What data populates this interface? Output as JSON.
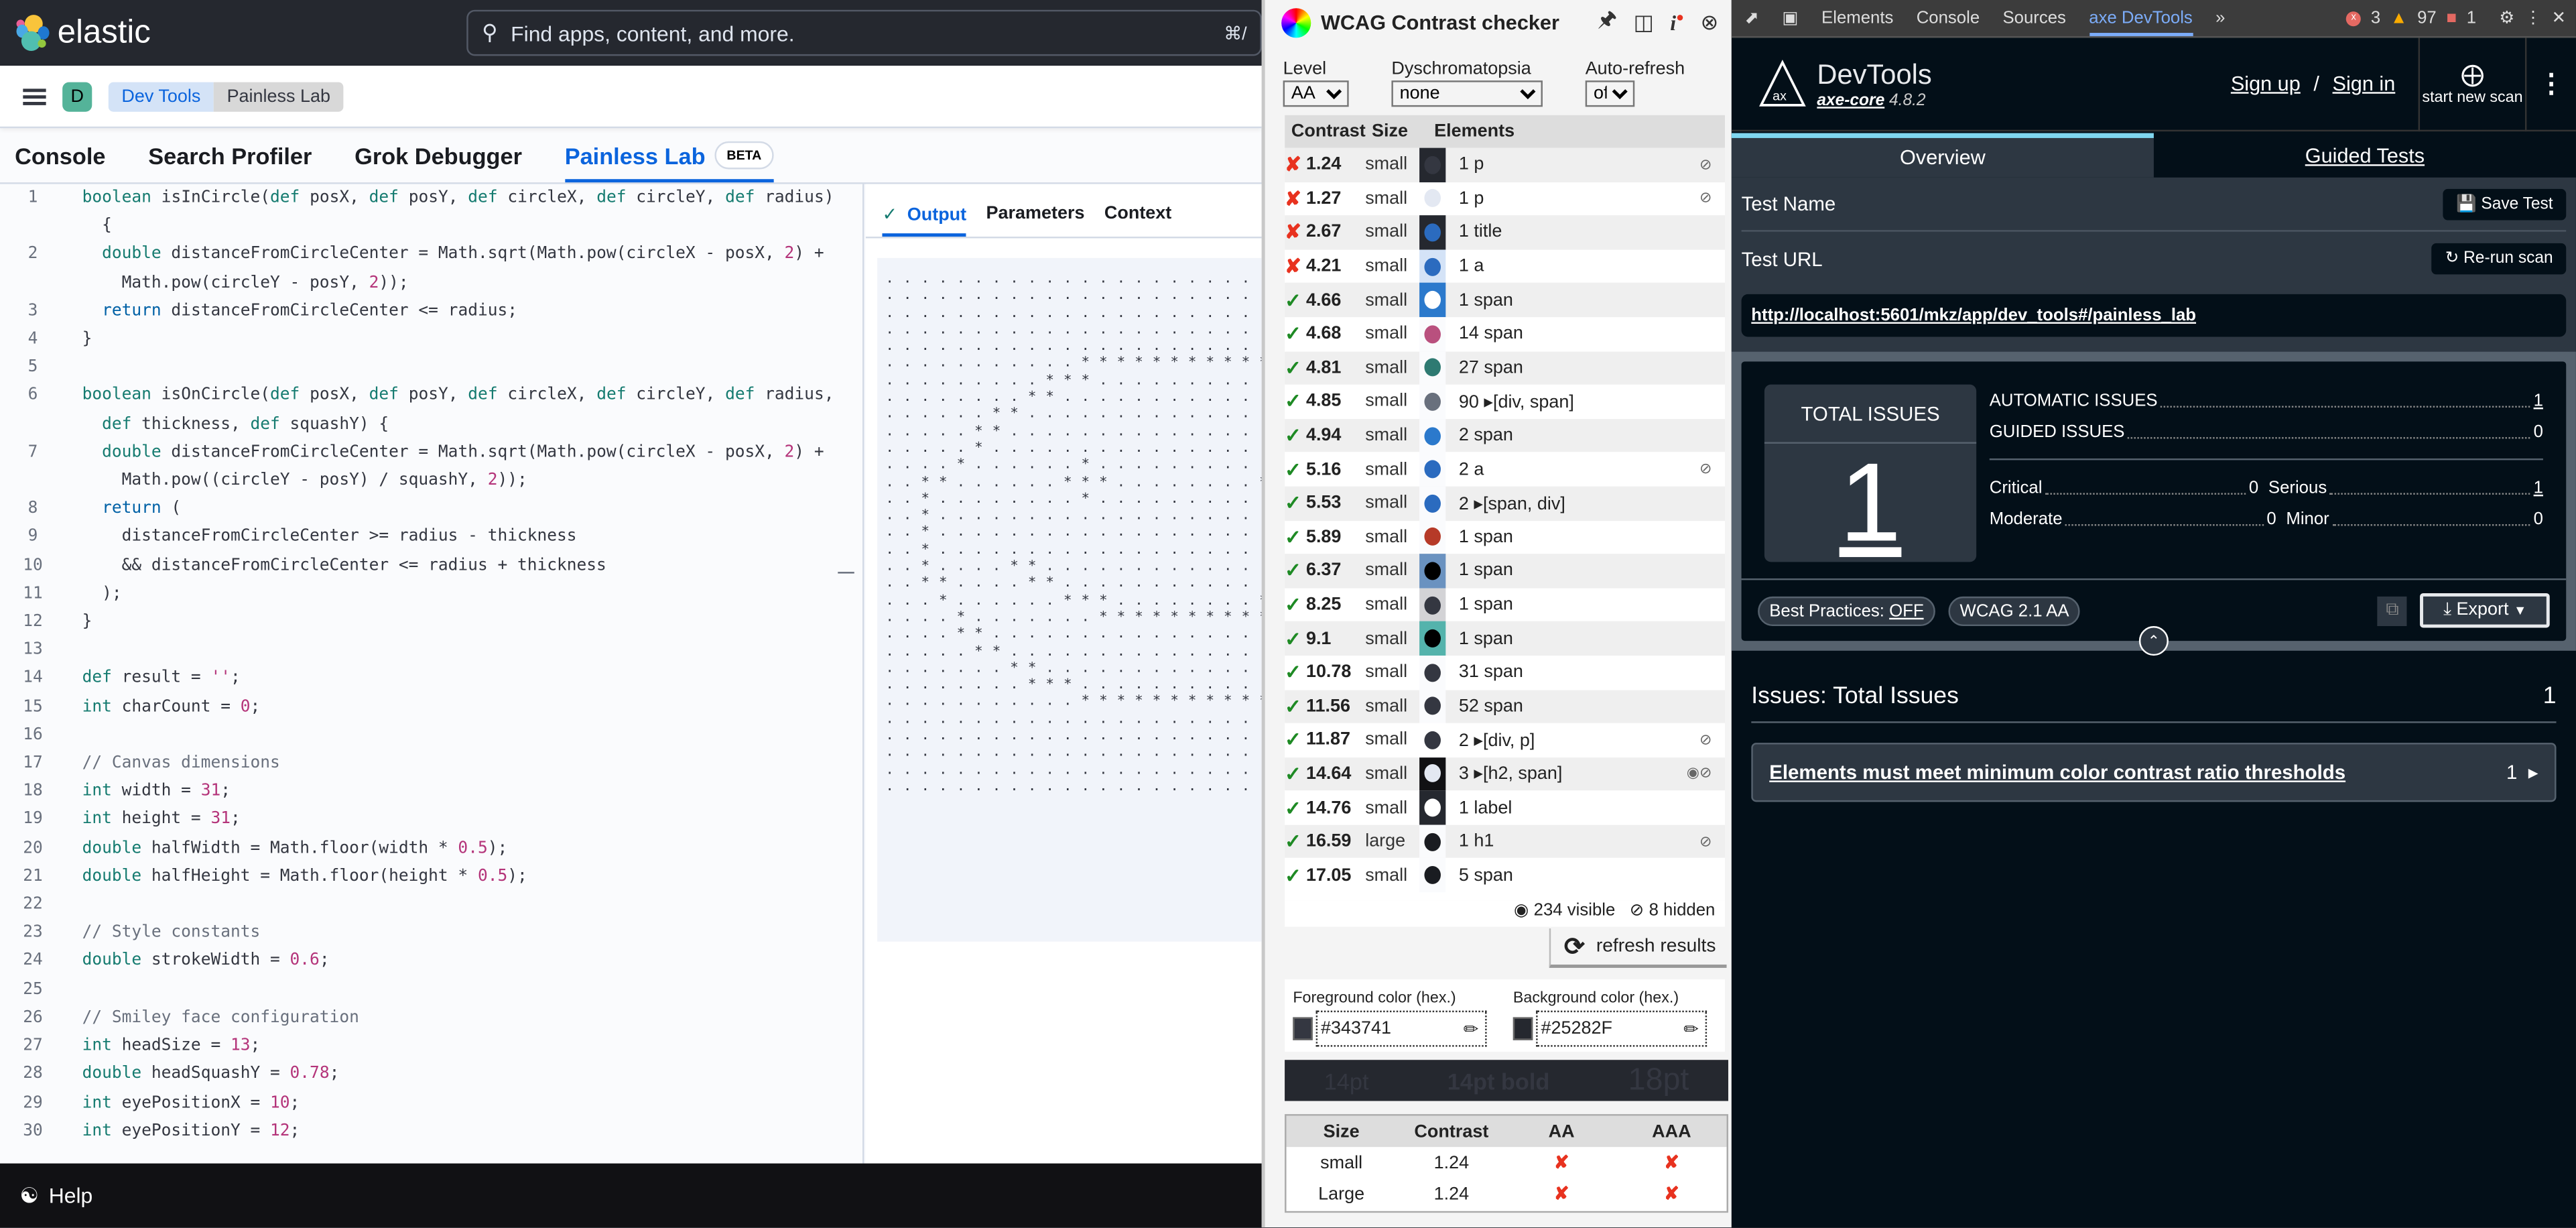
{
  "kibana": {
    "brand": "elastic",
    "search_placeholder": "Find apps, content, and more.",
    "search_shortcut": "⌘/",
    "avatar_letter": "D",
    "breadcrumbs": [
      "Dev Tools",
      "Painless Lab"
    ],
    "tabs": [
      {
        "label": "Console"
      },
      {
        "label": "Search Profiler"
      },
      {
        "label": "Grok Debugger"
      },
      {
        "label": "Painless Lab",
        "badge": "BETA",
        "active": true
      }
    ],
    "output_tabs": [
      "Output",
      "Parameters",
      "Context"
    ],
    "help_label": "Help",
    "code_lines": [
      {
        "n": "1",
        "html": "<span class='k'>boolean</span> isInCircle(<span class='k'>def</span> posX, <span class='k'>def</span> posY, <span class='k'>def</span> circleX, <span class='k'>def</span> circleY, <span class='k'>def</span> radius)"
      },
      {
        "n": "",
        "html": "  {"
      },
      {
        "n": "2",
        "html": "  <span class='k'>double</span> distanceFromCircleCenter = Math.sqrt(Math.pow(circleX - posX, <span class='n'>2</span>) +"
      },
      {
        "n": "",
        "html": "    Math.pow(circleY - posY, <span class='n'>2</span>));"
      },
      {
        "n": "3",
        "html": "  <span class='r'>return</span> distanceFromCircleCenter &lt;= radius;"
      },
      {
        "n": "4",
        "html": "}"
      },
      {
        "n": "5",
        "html": ""
      },
      {
        "n": "6",
        "html": "<span class='k'>boolean</span> isOnCircle(<span class='k'>def</span> posX, <span class='k'>def</span> posY, <span class='k'>def</span> circleX, <span class='k'>def</span> circleY, <span class='k'>def</span> radius,"
      },
      {
        "n": "",
        "html": "  <span class='k'>def</span> thickness, <span class='k'>def</span> squashY) {"
      },
      {
        "n": "7",
        "html": "  <span class='k'>double</span> distanceFromCircleCenter = Math.sqrt(Math.pow(circleX - posX, <span class='n'>2</span>) +"
      },
      {
        "n": "",
        "html": "    Math.pow((circleY - posY) / squashY, <span class='n'>2</span>));"
      },
      {
        "n": "8",
        "html": "  <span class='r'>return</span> ("
      },
      {
        "n": "9",
        "html": "    distanceFromCircleCenter &gt;= radius - thickness"
      },
      {
        "n": "10",
        "html": "    &amp;&amp; distanceFromCircleCenter &lt;= radius + thickness"
      },
      {
        "n": "11",
        "html": "  );"
      },
      {
        "n": "12",
        "html": "}"
      },
      {
        "n": "13",
        "html": ""
      },
      {
        "n": "14",
        "html": "<span class='k'>def</span> result = <span class='n'>''</span>;"
      },
      {
        "n": "15",
        "html": "<span class='k'>int</span> charCount = <span class='n'>0</span>;"
      },
      {
        "n": "16",
        "html": ""
      },
      {
        "n": "17",
        "html": "<span class='c'>// Canvas dimensions</span>"
      },
      {
        "n": "18",
        "html": "<span class='k'>int</span> width = <span class='n'>31</span>;"
      },
      {
        "n": "19",
        "html": "<span class='k'>int</span> height = <span class='n'>31</span>;"
      },
      {
        "n": "20",
        "html": "<span class='k'>double</span> halfWidth = Math.floor(width * <span class='n'>0.5</span>);"
      },
      {
        "n": "21",
        "html": "<span class='k'>double</span> halfHeight = Math.floor(height * <span class='n'>0.5</span>);"
      },
      {
        "n": "22",
        "html": ""
      },
      {
        "n": "23",
        "html": "<span class='c'>// Style constants</span>"
      },
      {
        "n": "24",
        "html": "<span class='k'>double</span> strokeWidth = <span class='n'>0.6</span>;"
      },
      {
        "n": "25",
        "html": ""
      },
      {
        "n": "26",
        "html": "<span class='c'>// Smiley face configuration</span>"
      },
      {
        "n": "27",
        "html": "<span class='k'>int</span> headSize = <span class='n'>13</span>;"
      },
      {
        "n": "28",
        "html": "<span class='k'>double</span> headSquashY = <span class='n'>0.78</span>;"
      },
      {
        "n": "29",
        "html": "<span class='k'>int</span> eyePositionX = <span class='n'>10</span>;"
      },
      {
        "n": "30",
        "html": "<span class='k'>int</span> eyePositionY = <span class='n'>12</span>;"
      }
    ],
    "output_text": ". . . . . . . . . . . . . . . . . . . . . .\n. . . . . . . . . . . . . . . . . . . . . .\n. . . . . . . . . . . . . . . . . . . . . .\n. . . . . . . . . . . . . . . . . . . . . .\n. . . . . . . . . . . . . . . . . . . . . .\n. . . . . . . . . . . * * * * * * * * * * *\n. . . . . . . . . * * * . . . . . . . . . .\n. . . . . . . . * * . . . . . . . . . . . .\n. . . . . . * * . . . . . . . . . . . . . .\n. . . . . * * . . . . . . . . . . . . . . .\n. . . . . * . . . . . . . . . . . . . . . .\n. . . . * . . . . . . * . . . . . . . . . .\n. . * * . . . . . . * * * . . . . . . . . *\n. . * . . . . . . . . * . . . . . . . . . .\n. . * . . . . . . . . . . . . . . . . . . .\n. . * . . . . . . . . . . . . . . . . . . .\n. . * . . . . . . . . . . . . . . . . . . .\n. . * . . . . * * . . . . . . . . . . . . .\n. . * * . . . . * * . . . . . . . . . . . .\n. . . * . . . . . . * * * . . . . . . . . *\n. . . . * . . . . . . . * * * * * * * * * *\n. . . . * * . . . . . . . . . . . . . . . .\n. . . . . * * . . . . . . . . . . . . . . .\n. . . . . . . * * . . . . . . . . . . . . .\n. . . . . . . . * * * . . . . . . . . . . .\n. . . . . . . . . . . * * * * * * * * * * *\n. . . . . . . . . . . . . . . . . . . . . .\n. . . . . . . . . . . . . . . . . . . . . .\n. . . . . . . . . . . . . . . . . . . . . .\n. . . . . . . . . . . . . . . . . . . . . .\n. . . . . . . . . . . . . . . . . . . . . ."
  },
  "wcag": {
    "title": "WCAG Contrast checker",
    "controls": {
      "level_label": "Level",
      "level_value": "AA",
      "dys_label": "Dyschromatopsia",
      "dys_value": "none",
      "auto_label": "Auto-refresh",
      "auto_value": "off"
    },
    "headers": [
      "Contrast",
      "Size",
      "Elements"
    ],
    "rows": [
      {
        "status": "fail",
        "contrast": "1.24",
        "size": "small",
        "bg": "#25282f",
        "fg": "#343741",
        "elements": "1 p",
        "hidden": true
      },
      {
        "status": "fail",
        "contrast": "1.27",
        "size": "small",
        "bg": "#ffffff",
        "fg": "#e3e8f2",
        "elements": "1 p",
        "hidden": true
      },
      {
        "status": "fail",
        "contrast": "2.67",
        "size": "small",
        "bg": "#25282f",
        "fg": "#2b6bbf",
        "elements": "1 title",
        "hidden": false
      },
      {
        "status": "fail",
        "contrast": "4.21",
        "size": "small",
        "bg": "#d4e3f7",
        "fg": "#2b6bbf",
        "elements": "1 a",
        "hidden": false
      },
      {
        "status": "pass",
        "contrast": "4.66",
        "size": "small",
        "bg": "#2b79cc",
        "fg": "#ffffff",
        "elements": "1 span",
        "hidden": false
      },
      {
        "status": "pass",
        "contrast": "4.68",
        "size": "small",
        "bg": "#fafbfd",
        "fg": "#b9507e",
        "elements": "14 span",
        "hidden": false
      },
      {
        "status": "pass",
        "contrast": "4.81",
        "size": "small",
        "bg": "#fafbfd",
        "fg": "#2e7a72",
        "elements": "27 span",
        "hidden": false
      },
      {
        "status": "pass",
        "contrast": "4.85",
        "size": "small",
        "bg": "#fafbfd",
        "fg": "#69707d",
        "elements": "90 ▸[div, span]",
        "hidden": false
      },
      {
        "status": "pass",
        "contrast": "4.94",
        "size": "small",
        "bg": "#fafbfd",
        "fg": "#2b79cc",
        "elements": "2 span",
        "hidden": false
      },
      {
        "status": "pass",
        "contrast": "5.16",
        "size": "small",
        "bg": "#fafbfd",
        "fg": "#2b6bbf",
        "elements": "2 a",
        "hidden": true
      },
      {
        "status": "pass",
        "contrast": "5.53",
        "size": "small",
        "bg": "#fafbfd",
        "fg": "#2b6bbf",
        "elements": "2 ▸[span, div]",
        "hidden": false
      },
      {
        "status": "pass",
        "contrast": "5.89",
        "size": "small",
        "bg": "#fafbfd",
        "fg": "#b63a28",
        "elements": "1 span",
        "hidden": false
      },
      {
        "status": "pass",
        "contrast": "6.37",
        "size": "small",
        "bg": "#6a92c0",
        "fg": "#000000",
        "elements": "1 span",
        "hidden": false
      },
      {
        "status": "pass",
        "contrast": "8.25",
        "size": "small",
        "bg": "#d3d3d6",
        "fg": "#343741",
        "elements": "1 span",
        "hidden": false
      },
      {
        "status": "pass",
        "contrast": "9.1",
        "size": "small",
        "bg": "#54b3ac",
        "fg": "#000000",
        "elements": "1 span",
        "hidden": false
      },
      {
        "status": "pass",
        "contrast": "10.78",
        "size": "small",
        "bg": "#fafbfd",
        "fg": "#343741",
        "elements": "31 span",
        "hidden": false
      },
      {
        "status": "pass",
        "contrast": "11.56",
        "size": "small",
        "bg": "#fafbfd",
        "fg": "#343741",
        "elements": "52 span",
        "hidden": false
      },
      {
        "status": "pass",
        "contrast": "11.87",
        "size": "small",
        "bg": "#ffffff",
        "fg": "#343741",
        "elements": "2 ▸[div, p]",
        "hidden": true
      },
      {
        "status": "pass",
        "contrast": "14.64",
        "size": "small",
        "bg": "#111114",
        "fg": "#e3e8f2",
        "elements": "3 ▸[h2, span]",
        "hidden": true,
        "visible_icon": true
      },
      {
        "status": "pass",
        "contrast": "14.76",
        "size": "small",
        "bg": "#25282f",
        "fg": "#ffffff",
        "elements": "1 label",
        "hidden": false
      },
      {
        "status": "pass",
        "contrast": "16.59",
        "size": "large",
        "bg": "#fafbfd",
        "fg": "#1a1c21",
        "elements": "1 h1",
        "hidden": true
      },
      {
        "status": "pass",
        "contrast": "17.05",
        "size": "small",
        "bg": "#fafbfd",
        "fg": "#1a1c21",
        "elements": "5 span",
        "hidden": false
      }
    ],
    "visible_count": "234 visible",
    "hidden_count": "8 hidden",
    "refresh_label": "refresh results",
    "fg_label": "Foreground color (hex.)",
    "fg_value": "#343741",
    "bg_label": "Background color (hex.)",
    "bg_value": "#25282F",
    "preview": [
      "14pt",
      "14pt bold",
      "18pt"
    ],
    "result_headers": [
      "Size",
      "Contrast",
      "AA",
      "AAA"
    ],
    "results": [
      {
        "size": "small",
        "contrast": "1.24",
        "aa": "✘",
        "aaa": "✘"
      },
      {
        "size": "Large",
        "contrast": "1.24",
        "aa": "✘",
        "aaa": "✘"
      }
    ]
  },
  "devtools": {
    "tabs": [
      "Elements",
      "Console",
      "Sources",
      "axe DevTools"
    ],
    "active_tab": "axe DevTools",
    "errors": "3",
    "warnings": "97",
    "issues": "1",
    "axe": {
      "name": "DevTools",
      "core_label": "axe-core",
      "core_version": "4.8.2",
      "sign_up": "Sign up",
      "sign_in": "Sign in",
      "start_scan": "start new scan",
      "tabs": [
        "Overview",
        "Guided Tests"
      ],
      "test_name_label": "Test Name",
      "save_test": "Save Test",
      "test_url_label": "Test URL",
      "rerun": "Re-run scan",
      "url": "http://localhost:5601/mkz/app/dev_tools#/painless_lab",
      "total_label": "TOTAL ISSUES",
      "total": "1",
      "automatic_label": "AUTOMATIC ISSUES",
      "automatic": "1",
      "guided_label": "GUIDED ISSUES",
      "guided": "0",
      "critical_label": "Critical",
      "critical": "0",
      "serious_label": "Serious",
      "serious": "1",
      "moderate_label": "Moderate",
      "moderate": "0",
      "minor_label": "Minor",
      "minor": "0",
      "best_practices": "Best Practices:",
      "best_practices_value": "OFF",
      "standard": "WCAG 2.1 AA",
      "export": "Export",
      "issues_heading": "Issues: Total Issues",
      "issues_count": "1",
      "issue_list": [
        {
          "title": "Elements must meet minimum color contrast ratio thresholds",
          "count": "1"
        }
      ]
    }
  }
}
